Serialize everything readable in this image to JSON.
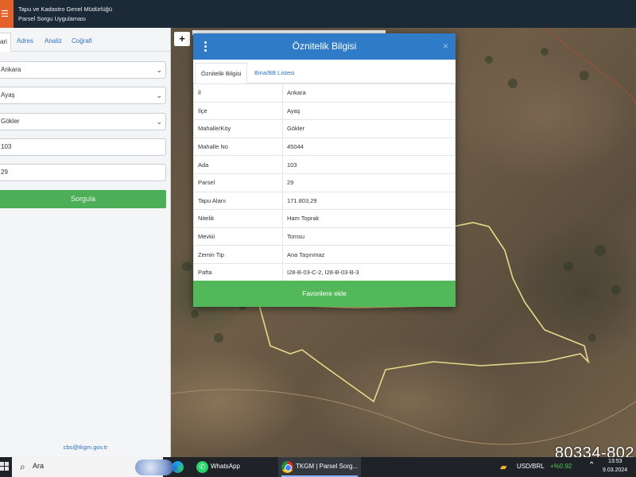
{
  "header": {
    "menu_icon": "hamburger-icon",
    "title_line1": "Tapu ve Kadastro Genel Müdürlüğü",
    "title_line2": "Parsel Sorgu Uygulaması"
  },
  "left_panel": {
    "tabs": [
      {
        "label": "ari"
      },
      {
        "label": "Adres"
      },
      {
        "label": "Analiz"
      },
      {
        "label": "Coğrafi"
      }
    ],
    "fields": [
      {
        "value": "Ankara"
      },
      {
        "value": "Ayaş"
      },
      {
        "value": "Gökler"
      },
      {
        "value": "103"
      },
      {
        "value": "29"
      }
    ],
    "search_button": "Sorgula",
    "footer_email": "cbs@tkgm.gov.tr"
  },
  "map": {
    "zoom_in_label": "+"
  },
  "modal": {
    "title": "Öznitelik Bilgisi",
    "close_label": "×",
    "tabs": [
      {
        "label": "Öznitelik Bilgisi"
      },
      {
        "label": "Bina/BB Listesi"
      }
    ],
    "attributes": [
      {
        "key": "İl",
        "value": "Ankara"
      },
      {
        "key": "İlçe",
        "value": "Ayaş"
      },
      {
        "key": "Mahalle/Köy",
        "value": "Gökler"
      },
      {
        "key": "Mahalle No",
        "value": "45044"
      },
      {
        "key": "Ada",
        "value": "103"
      },
      {
        "key": "Parsel",
        "value": "29"
      },
      {
        "key": "Tapu Alanı",
        "value": "171.803,29"
      },
      {
        "key": "Nitelik",
        "value": "Ham Toprak"
      },
      {
        "key": "Mevkii",
        "value": "Tomsu"
      },
      {
        "key": "Zemin Tip",
        "value": "Ana Taşınmaz"
      },
      {
        "key": "Pafta",
        "value": "I28-B-03-C-2, I28-B-03-B-3"
      }
    ],
    "favorite_button": "Favorilere ekle"
  },
  "overlay_number": "80334-802",
  "taskbar": {
    "search_placeholder": "Ara",
    "apps": [
      {
        "label": "WhatsApp",
        "icon": "whatsapp-icon"
      },
      {
        "label": "TKGM | Parsel Sorg...",
        "icon": "chrome-icon"
      }
    ],
    "stock_name": "USD/BRL",
    "stock_change": "+%0.92",
    "time": "13:53",
    "date": "9.03.2024"
  },
  "colors": {
    "header_bg": "#1c2a38",
    "accent_orange": "#e3622a",
    "modal_header": "#2f7bc7",
    "green_button": "#4cae56",
    "link_blue": "#2d74c4"
  }
}
